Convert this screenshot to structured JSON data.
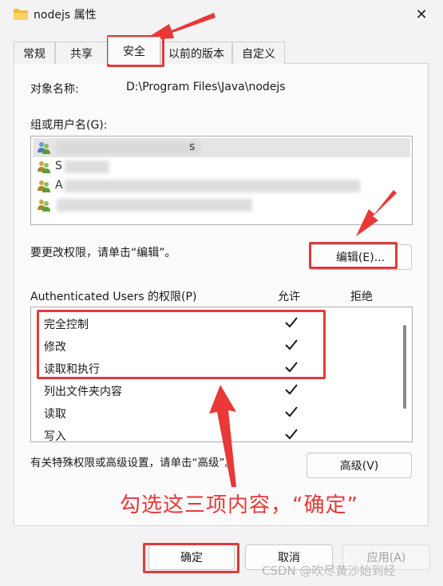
{
  "window": {
    "title": "nodejs 属性",
    "close_label": "✕"
  },
  "tabs": [
    {
      "label": "常规",
      "active": false
    },
    {
      "label": "共享",
      "active": false
    },
    {
      "label": "安全",
      "active": true
    },
    {
      "label": "以前的版本",
      "active": false
    },
    {
      "label": "自定义",
      "active": false
    }
  ],
  "security": {
    "object_name_label": "对象名称:",
    "object_name_value": "D:\\Program Files\\Java\\nodejs",
    "groups_label": "组或用户名(G):",
    "users": [
      {
        "name": "s",
        "selected": true
      },
      {
        "name": "S",
        "selected": false
      },
      {
        "name": "A",
        "selected": false
      },
      {
        "name": "",
        "selected": false
      }
    ],
    "change_hint": "要更改权限，请单击“编辑”。",
    "edit_button": "编辑(E)...",
    "permissions_label": "Authenticated Users 的权限(P)",
    "allow_header": "允许",
    "deny_header": "拒绝",
    "permissions": [
      {
        "name": "完全控制",
        "allow": true,
        "deny": false
      },
      {
        "name": "修改",
        "allow": true,
        "deny": false
      },
      {
        "name": "读取和执行",
        "allow": true,
        "deny": false
      },
      {
        "name": "列出文件夹内容",
        "allow": true,
        "deny": false
      },
      {
        "name": "读取",
        "allow": true,
        "deny": false
      },
      {
        "name": "写入",
        "allow": true,
        "deny": false
      }
    ],
    "advanced_hint": "有关特殊权限或高级设置，请单击“高级”。",
    "advanced_button": "高级(V)"
  },
  "footer": {
    "ok_button": "确定",
    "cancel_button": "取消",
    "apply_button": "应用(A)"
  },
  "annotation": {
    "text": "勾选这三项内容，“确定”",
    "color": "#e83838"
  },
  "watermark": "CSDN @吹尽黄沙始到经"
}
